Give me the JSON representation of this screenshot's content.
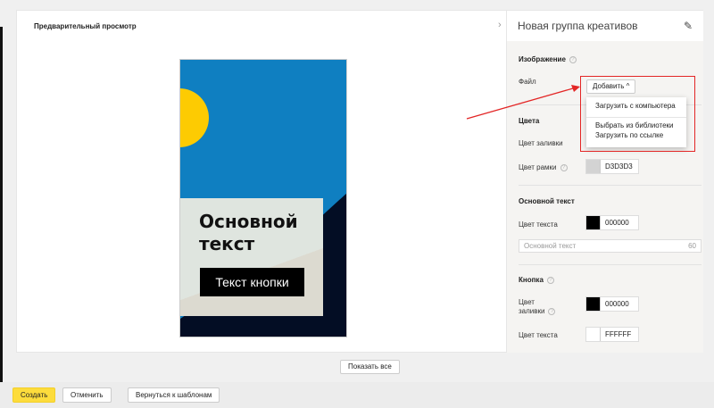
{
  "preview": {
    "title": "Предварительный просмотр",
    "banner_text": "Основной текст",
    "banner_button": "Текст кнопки",
    "show_all": "Показать все"
  },
  "panel": {
    "title": "Новая группа креативов",
    "image_section": "Изображение",
    "file_label": "Файл",
    "add_button": "Добавить ^",
    "menu": [
      "Загрузить с компьютера",
      "Выбрать из библиотеки",
      "Загрузить по ссылке"
    ],
    "colors_section": "Цвета",
    "fill_label": "Цвет заливки",
    "border_label": "Цвет рамки",
    "border_value": "D3D3D3",
    "main_text_section": "Основной текст",
    "text_color_label": "Цвет текста",
    "text_color_value": "000000",
    "text_placeholder": "Основной текст",
    "text_limit": "60",
    "button_section": "Кнопка",
    "btn_fill_label_1": "Цвет",
    "btn_fill_label_2": "заливки",
    "btn_fill_value": "000000",
    "btn_text_label": "Цвет текста",
    "btn_text_value": "FFFFFF"
  },
  "footer": {
    "create": "Создать",
    "cancel": "Отменить",
    "back": "Вернуться к шаблонам"
  },
  "colors": {
    "accent": "#fddc3c",
    "highlight": "#e32626",
    "banner_bg": "#0f7fc1"
  }
}
